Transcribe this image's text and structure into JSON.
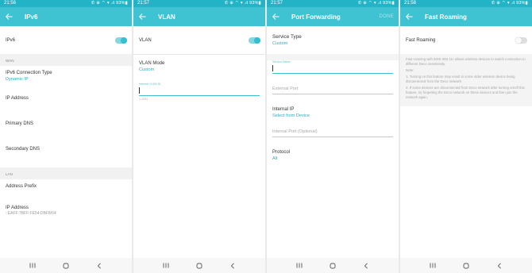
{
  "screens": [
    {
      "time": "21:56",
      "status_icons": "✆ ⊕ ⌔ ▾ .ıl 93%▮",
      "title": "IPv6",
      "rows": {
        "ipv6_label": "IPv6",
        "ipv6_enabled": true,
        "wan_header": "WAN",
        "connection_type_label": "IPv6 Connection Type",
        "connection_type_value": "Dynamic IP",
        "ip_address_label": "IP Address",
        "primary_dns_label": "Primary DNS",
        "secondary_dns_label": "Secondary DNS",
        "lan_header": "LAN",
        "address_prefix_label": "Address Prefix",
        "lan_ip_label": "IP Address",
        "lan_ip_value": "::EAFF:7BFF:FE54:DBF8/64"
      }
    },
    {
      "time": "21:57",
      "status_icons": "✆ ⊕ ⌔ ▾ .ıl 93%▮",
      "title": "VLAN",
      "rows": {
        "vlan_label": "VLAN",
        "vlan_enabled": true,
        "vlan_mode_label": "VLAN Mode",
        "vlan_mode_value": "Custom",
        "internet_vlan_id_label": "Internet VLAN ID",
        "helper": "1-4094"
      }
    },
    {
      "time": "21:57",
      "status_icons": "✆ ⊕ ⌔ ▾ .ıl 93%▮",
      "title": "Port Forwarding",
      "done_label": "DONE",
      "rows": {
        "service_type_label": "Service Type",
        "service_type_value": "Custom",
        "service_name_label": "Service Name",
        "external_port_placeholder": "External Port",
        "internal_ip_label": "Internal IP",
        "internal_ip_value": "Select from Device",
        "internal_port_placeholder": "Internal Port (Optional)",
        "protocol_label": "Protocol",
        "protocol_value": "All"
      }
    },
    {
      "time": "21:58",
      "status_icons": "✆ ⊕ ⌔ ▾ .ıl 93%▮",
      "title": "Fast Roaming",
      "rows": {
        "fast_roaming_label": "Fast Roaming",
        "fast_roaming_enabled": false,
        "description": "Fast roaming with IEEE 802.11r allows wireless devices to switch connection to different Deco seamlessly.",
        "note_label": "Note:",
        "note_1": "1. Turning on this feature may result in some older wireless device being disconnected from the Deco network.",
        "note_2": "2. If some devices are disconnected from Deco network after turning on/off this feature, try forgetting the Deco network on these devices and then join the network again."
      }
    }
  ],
  "navbar": {
    "recents_icon": "recents-icon",
    "home_icon": "home-icon",
    "back_icon": "nav-back-icon"
  },
  "colors": {
    "statusbar": "#22b4c6",
    "appbar": "#3fc3d3",
    "accent": "#27aec2",
    "toggle_on": "#34bfd0"
  }
}
